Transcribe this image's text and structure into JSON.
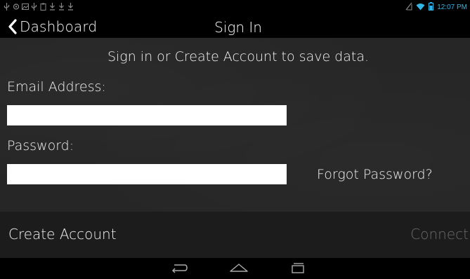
{
  "status_bar": {
    "time": "12:07 PM",
    "left_icons": [
      "usb-icon",
      "gps-icon",
      "image-icon",
      "usb-icon",
      "clipboard-icon",
      "download-icon",
      "download-icon",
      "download-icon"
    ],
    "accent_color": "#33b5e5"
  },
  "header": {
    "back_label": "Dashboard",
    "title": "Sign In"
  },
  "main": {
    "subtitle": "Sign in or Create Account to save data.",
    "email_label": "Email Address:",
    "email_value": "",
    "password_label": "Password:",
    "password_value": "",
    "forgot_label": "Forgot Password?"
  },
  "footer": {
    "create_label": "Create Account",
    "connect_label": "Connect"
  },
  "nav_bar": {
    "icons": [
      "back-icon",
      "home-icon",
      "recent-apps-icon"
    ]
  },
  "colors": {
    "content_bg": "#262626",
    "footer_bg": "#1c1c1c",
    "disabled_text": "#6a6a6a"
  }
}
